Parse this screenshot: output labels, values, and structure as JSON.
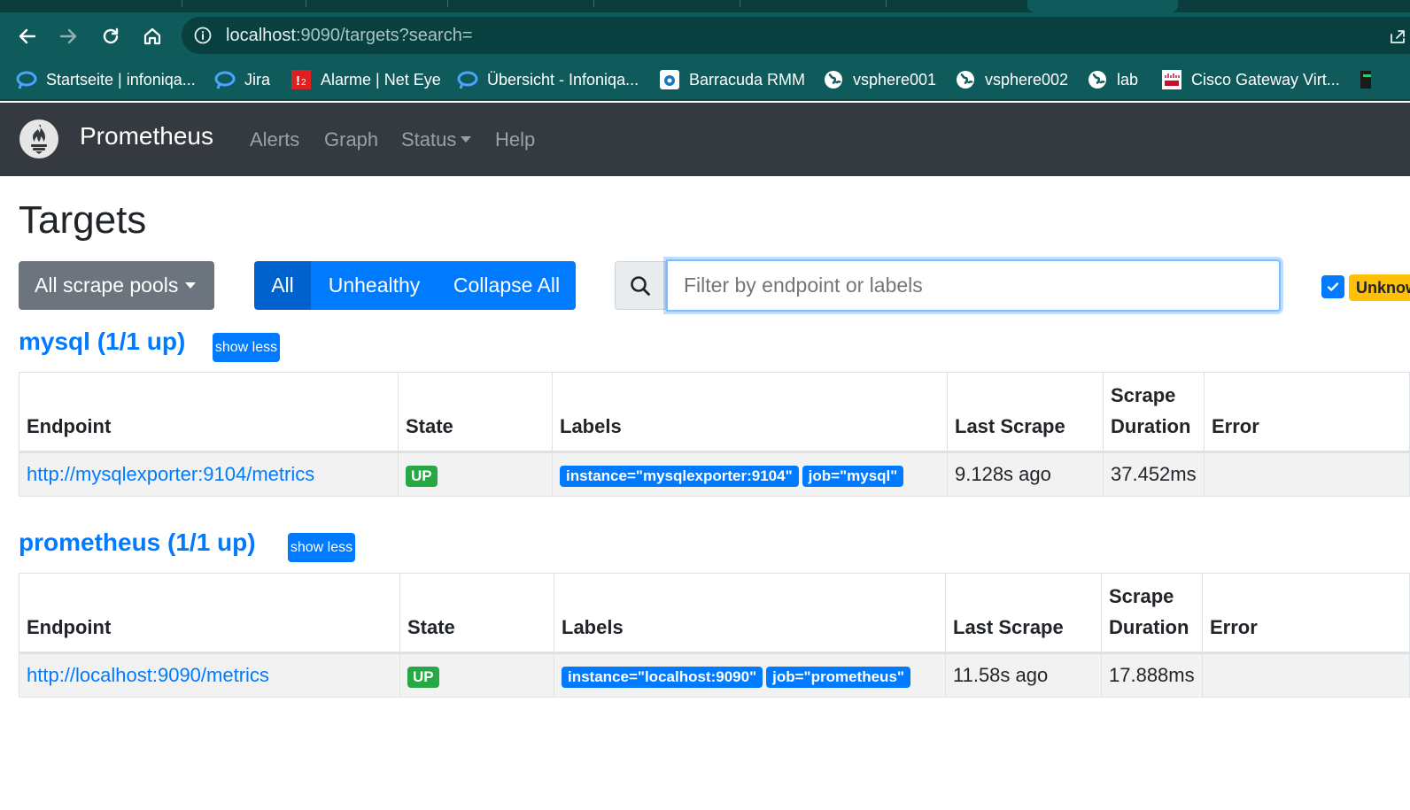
{
  "browser": {
    "url_host": "localhost",
    "url_path": ":9090/targets?search=",
    "bookmarks": [
      {
        "label": "Startseite | infoniqa...",
        "icon": "infoniqa-icon"
      },
      {
        "label": "Jira",
        "icon": "infoniqa-icon"
      },
      {
        "label": "Alarme | Net Eye",
        "icon": "neteye-icon"
      },
      {
        "label": "Übersicht - Infoniqa...",
        "icon": "infoniqa-icon"
      },
      {
        "label": "Barracuda RMM",
        "icon": "barracuda-icon"
      },
      {
        "label": "vsphere001",
        "icon": "globe-icon"
      },
      {
        "label": "vsphere002",
        "icon": "globe-icon"
      },
      {
        "label": "lab",
        "icon": "globe-icon"
      },
      {
        "label": "Cisco Gateway Virt...",
        "icon": "cisco-icon"
      }
    ]
  },
  "navbar": {
    "brand": "Prometheus",
    "links": {
      "alerts": "Alerts",
      "graph": "Graph",
      "status": "Status",
      "help": "Help"
    }
  },
  "page": {
    "title": "Targets",
    "pool_dropdown": "All scrape pools",
    "filters": {
      "all": "All",
      "unhealthy": "Unhealthy",
      "collapse": "Collapse All"
    },
    "search_placeholder": "Filter by endpoint or labels",
    "unknown_badge": "Unknown"
  },
  "columns": {
    "endpoint": "Endpoint",
    "state": "State",
    "labels": "Labels",
    "last_scrape": "Last Scrape",
    "scrape_duration": "Scrape Duration",
    "error": "Error"
  },
  "pools": [
    {
      "title": "mysql (1/1 up)",
      "toggle": "show less",
      "rows": [
        {
          "endpoint": "http://mysqlexporter:9104/metrics",
          "state": "UP",
          "labels": [
            "instance=\"mysqlexporter:9104\"",
            "job=\"mysql\""
          ],
          "last_scrape": "9.128s ago",
          "duration": "37.452ms",
          "error": ""
        }
      ]
    },
    {
      "title": "prometheus (1/1 up)",
      "toggle": "show less",
      "rows": [
        {
          "endpoint": "http://localhost:9090/metrics",
          "state": "UP",
          "labels": [
            "instance=\"localhost:9090\"",
            "job=\"prometheus\""
          ],
          "last_scrape": "11.58s ago",
          "duration": "17.888ms",
          "error": ""
        }
      ]
    }
  ],
  "colors": {
    "primary": "#007bff",
    "success": "#28a745",
    "navbar": "#343a40",
    "browser": "#0f5a5a",
    "warning": "#ffc107"
  }
}
